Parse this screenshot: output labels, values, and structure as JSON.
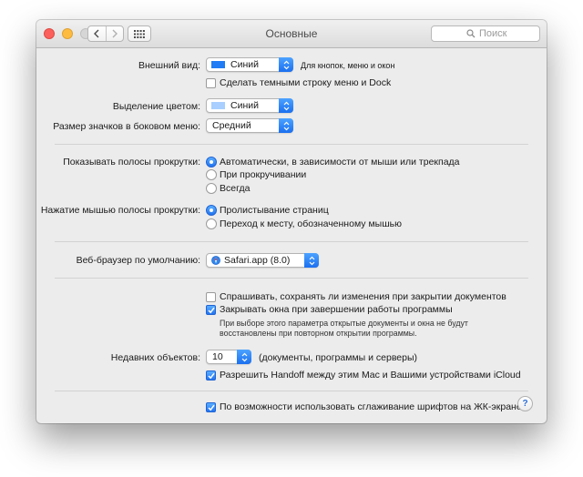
{
  "window": {
    "title": "Основные"
  },
  "search": {
    "placeholder": "Поиск"
  },
  "appearance": {
    "label": "Внешний вид:",
    "value": "Синий",
    "swatch_color": "#1f7cf4",
    "hint": "Для кнопок, меню и окон",
    "dark_bar_label": "Сделать темными строку меню и Dock",
    "dark_bar_checked": false
  },
  "highlight": {
    "label": "Выделение цветом:",
    "value": "Синий",
    "swatch_color": "#a8cfff"
  },
  "sidebar_icon": {
    "label": "Размер значков в боковом меню:",
    "value": "Средний"
  },
  "scrollbars": {
    "label": "Показывать полосы прокрутки:",
    "options": [
      {
        "label": "Автоматически, в зависимости от мыши или трекпада",
        "selected": true
      },
      {
        "label": "При прокручивании",
        "selected": false
      },
      {
        "label": "Всегда",
        "selected": false
      }
    ]
  },
  "click_scrollbar": {
    "label": "Нажатие мышью полосы прокрутки:",
    "options": [
      {
        "label": "Пролистывание страниц",
        "selected": true
      },
      {
        "label": "Переход к месту, обозначенному мышью",
        "selected": false
      }
    ]
  },
  "browser": {
    "label": "Веб-браузер по умолчанию:",
    "value": "Safari.app (8.0)"
  },
  "documents": {
    "ask_save_label": "Спрашивать, сохранять ли изменения при закрытии документов",
    "ask_save_checked": false,
    "close_windows_label": "Закрывать окна при завершении работы программы",
    "close_windows_checked": true,
    "note_line1": "При выборе этого параметра открытые документы и окна не будут",
    "note_line2": "восстановлены при повторном открытии программы."
  },
  "recent": {
    "label": "Недавних объектов:",
    "value": "10",
    "hint": "(документы, программы и серверы)"
  },
  "handoff": {
    "label": "Разрешить Handoff между этим Mac и Вашими устройствами iCloud",
    "checked": true
  },
  "font_smoothing": {
    "label": "По возможности использовать сглаживание шрифтов на ЖК-экране",
    "checked": true
  },
  "help": {
    "label": "?"
  }
}
